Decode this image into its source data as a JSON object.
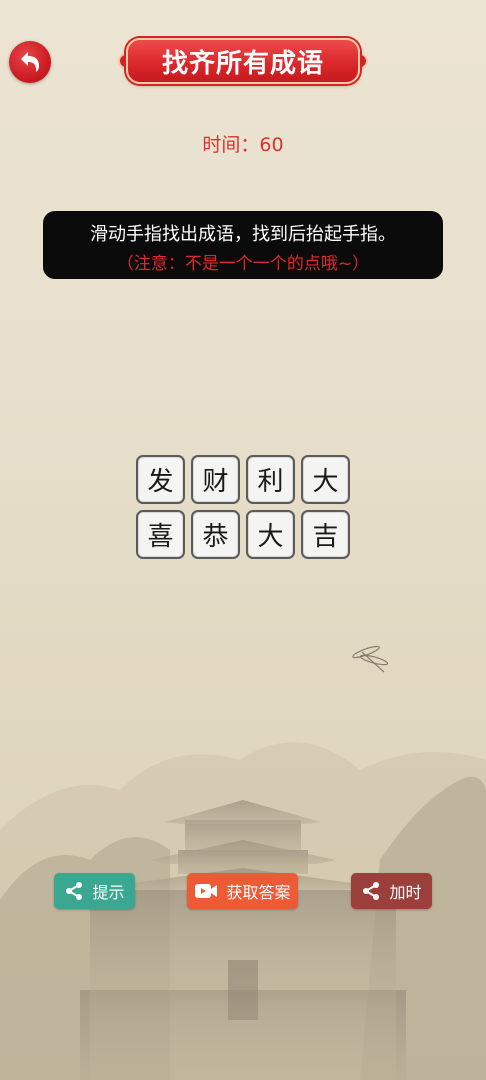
{
  "header": {
    "back_icon": "back-arrow-icon",
    "title": "找齐所有成语"
  },
  "timer": {
    "label": "时间：60"
  },
  "instructions": {
    "line1": "滑动手指找出成语，找到后抬起手指。",
    "line2": "（注意：不是一个一个的点哦~）"
  },
  "grid": {
    "rows": [
      [
        "发",
        "财",
        "利",
        "大"
      ],
      [
        "喜",
        "恭",
        "大",
        "吉"
      ]
    ]
  },
  "buttons": {
    "hint": {
      "label": "提示",
      "icon": "share-icon",
      "color": "#3aa890"
    },
    "answer": {
      "label": "获取答案",
      "icon": "video-icon",
      "color": "#ee5a35"
    },
    "add_time": {
      "label": "加时",
      "icon": "share-icon",
      "color": "#9a3f3a"
    }
  },
  "colors": {
    "accent_red": "#d32428",
    "timer_red": "#d8332c"
  }
}
